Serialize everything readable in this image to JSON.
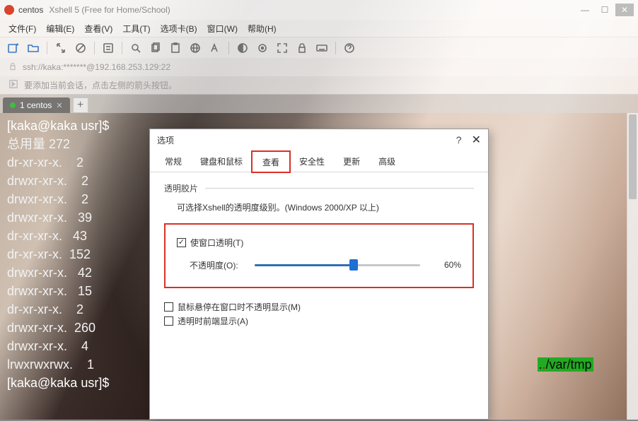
{
  "titlebar": {
    "session": "centos",
    "app": "Xshell 5 (Free for Home/School)"
  },
  "menubar": [
    "文件(F)",
    "编辑(E)",
    "查看(V)",
    "工具(T)",
    "选项卡(B)",
    "窗口(W)",
    "帮助(H)"
  ],
  "address": "ssh://kaka:*******@192.168.253.129:22",
  "hint": "要添加当前会话，点击左侧的箭头按钮。",
  "tab": {
    "label": "1 centos"
  },
  "terminal": {
    "lines": [
      "[kaka@kaka usr]$",
      "总用量 272",
      "dr-xr-xr-x.    2",
      "drwxr-xr-x.    2",
      "drwxr-xr-x.    2",
      "drwxr-xr-x.   39",
      "dr-xr-xr-x.   43",
      "dr-xr-xr-x.  152",
      "drwxr-xr-x.   42",
      "drwxr-xr-x.   15",
      "dr-xr-xr-x.    2",
      "drwxr-xr-x.  260",
      "drwxr-xr-x.    4",
      "lrwxrwxrwx.    1",
      "[kaka@kaka usr]$"
    ],
    "link": "../var/tmp"
  },
  "dialog": {
    "title": "选项",
    "tabs": [
      "常规",
      "键盘和鼠标",
      "查看",
      "安全性",
      "更新",
      "高级"
    ],
    "active_tab": "查看",
    "section": "透明胶片",
    "desc": "可选择Xshell的透明度级别。(Windows 2000/XP 以上)",
    "opt_transparent": "使窗口透明(T)",
    "opacity_label": "不透明度(O):",
    "opacity_value": "60%",
    "opacity_pct": 60,
    "opt_hover": "鼠标悬停在窗口时不透明显示(M)",
    "opt_front": "透明时前端显示(A)"
  }
}
